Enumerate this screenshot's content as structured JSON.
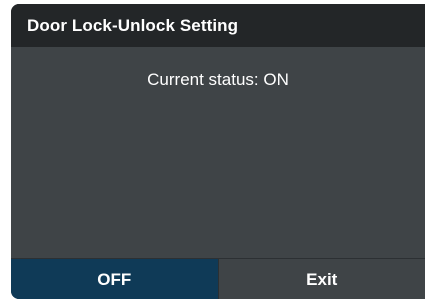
{
  "dialog": {
    "title": "Door Lock-Unlock Setting",
    "status_text": "Current status: ON"
  },
  "buttons": {
    "off_label": "OFF",
    "exit_label": "Exit"
  },
  "colors": {
    "title_bar": "#232628",
    "body": "#3f4447",
    "selected_button": "#0f3a57",
    "text": "#ffffff"
  }
}
